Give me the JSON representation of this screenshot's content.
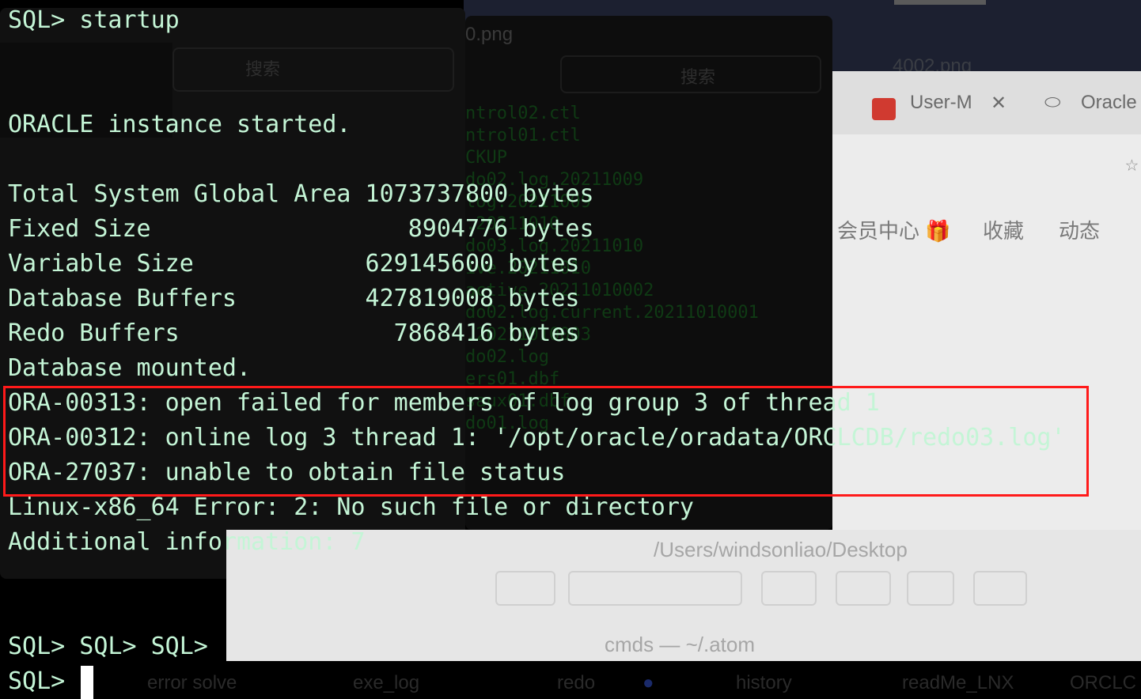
{
  "background": {
    "finder_back": {
      "title": "0.png",
      "search_placeholder": "搜索",
      "sidebar": [
        "收藏",
        "动态"
      ]
    },
    "finder_mid": {
      "search_placeholder": "搜索",
      "files": [
        "ntrol02.ctl",
        "ntrol01.ctl",
        "CKUP",
        "do02.log.20211009",
        "log.20211009",
        ".20211010",
        "do03.log.20211010",
        "ive.20211010",
        "active.20211010002",
        "do02.log.current.20211010001",
        ".20211010003",
        "do02.log",
        "ers01.dbf",
        "saux01.dbf",
        "do01.log"
      ]
    },
    "thumbnail_name": "4002.png",
    "browser": {
      "tabs": [
        "User-M",
        "Oracle"
      ],
      "nav": [
        "会员中心 🎁",
        "收藏",
        "动态"
      ]
    },
    "finder_front": {
      "path": "/Users/windsonliao/Desktop",
      "file": "cmds — ~/.atom"
    },
    "bottom_tabs": [
      "error solve",
      "exe_log",
      "redo",
      "history",
      "readMe_LNX",
      "ORCLC"
    ]
  },
  "terminal": {
    "lines": [
      "SQL> startup",
      "ORACLE instance started.",
      "Total System Global Area 1073737800 bytes",
      "Fixed Size                  8904776 bytes",
      "Variable Size            629145600 bytes",
      "Database Buffers         427819008 bytes",
      "Redo Buffers               7868416 bytes",
      "Database mounted.",
      "ORA-00313: open failed for members of log group 3 of thread 1",
      "ORA-00312: online log 3 thread 1: '/opt/oracle/oradata/ORCLCDB/redo03.log'",
      "ORA-27037: unable to obtain file status",
      "Linux-x86_64 Error: 2: No such file or directory",
      "Additional information: 7",
      "SQL> SQL> SQL>",
      "SQL> "
    ]
  },
  "colors": {
    "terminal_text": "#c4f5d6",
    "highlight_border": "#ff1a1a",
    "cursor": "#ffffff"
  }
}
